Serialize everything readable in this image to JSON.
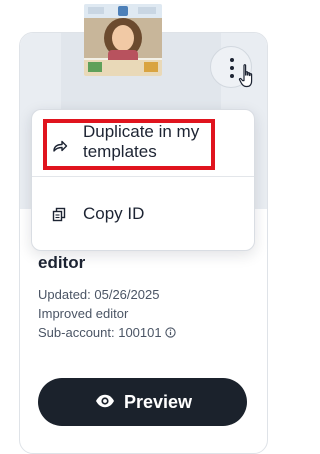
{
  "card": {
    "title": "editor",
    "updated": "Updated: 05/26/2025",
    "description": "Improved editor",
    "subaccount": "Sub-account: 100101",
    "preview_label": "Preview"
  },
  "menu": {
    "items": [
      {
        "label": "Duplicate in my templates",
        "icon": "share-arrow-icon"
      },
      {
        "label": "Copy ID",
        "icon": "copy-icon"
      }
    ]
  },
  "colors": {
    "highlight": "#e0141e",
    "preview_bg": "#1b222c",
    "text": "#1d2433"
  }
}
